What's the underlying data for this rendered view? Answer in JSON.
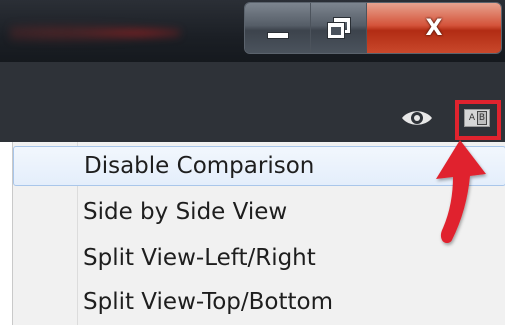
{
  "window": {
    "controls": {
      "minimize_icon": "minimize-icon",
      "maximize_icon": "restore-icon",
      "close_label": "X"
    }
  },
  "toolbar": {
    "view_icon": "eye-icon",
    "compare_icon": "ab-compare-icon",
    "compare_icon_letters": [
      "A",
      "B"
    ]
  },
  "menu": {
    "items": [
      {
        "label": "Disable Comparison",
        "selected": true
      },
      {
        "label": "Side by Side View",
        "selected": false
      },
      {
        "label": "Split View-Left/Right",
        "selected": false
      },
      {
        "label": "Split View-Top/Bottom",
        "selected": false
      }
    ]
  },
  "annotation": {
    "highlight_color": "#e0232e",
    "arrow_color": "#e0232e"
  }
}
